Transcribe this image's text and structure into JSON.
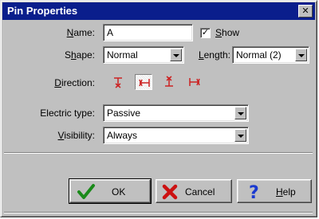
{
  "window": {
    "title": "Pin Properties"
  },
  "name_field": {
    "label": "Name:",
    "label_key": "N",
    "label_rest": "ame:",
    "value": "A"
  },
  "show_checkbox": {
    "label": "Show",
    "label_key": "S",
    "label_rest": "how",
    "checked": true
  },
  "shape_field": {
    "label": "Shape:",
    "label_pre": "S",
    "label_key": "h",
    "label_rest": "ape:",
    "value": "Normal"
  },
  "length_field": {
    "label": "Length:",
    "label_key": "L",
    "label_rest": "ength:",
    "value": "Normal (2)"
  },
  "direction": {
    "label": "Direction:",
    "label_key": "D",
    "label_rest": "irection:",
    "options": [
      {
        "icon": "pin-direction-down-icon",
        "selected": false
      },
      {
        "icon": "pin-direction-left-icon",
        "selected": true
      },
      {
        "icon": "pin-direction-up-icon",
        "selected": false
      },
      {
        "icon": "pin-direction-right-icon",
        "selected": false
      }
    ],
    "color": "#cc2222"
  },
  "electric_type": {
    "label": "Electric type:",
    "value": "Passive"
  },
  "visibility": {
    "label": "Visibility:",
    "label_key": "V",
    "label_rest": "isibility:",
    "value": "Always"
  },
  "buttons": {
    "ok": {
      "label": "OK",
      "icon": "checkmark-icon"
    },
    "cancel": {
      "label": "Cancel",
      "icon": "x-mark-icon"
    },
    "help": {
      "label": "Help",
      "label_key": "H",
      "label_rest": "elp",
      "icon": "question-mark-icon"
    }
  },
  "colors": {
    "title_bar": "#0a1e8c",
    "dialog_bg": "#c0c0c0",
    "ok_icon": "#1a8a1a",
    "cancel_icon": "#cc1111",
    "help_icon": "#1a3ad0"
  }
}
